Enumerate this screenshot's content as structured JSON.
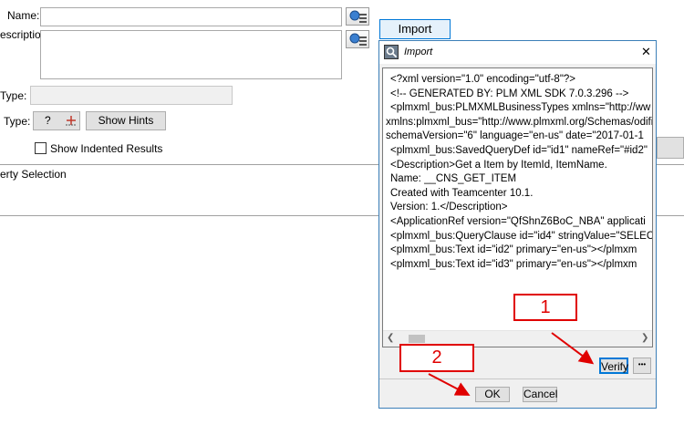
{
  "form": {
    "name_label": "Name:",
    "description_label": "escription:",
    "type_label_1": "Type:",
    "type_label_2": "Type:",
    "type_value": "?",
    "show_hints_label": "Show Hints",
    "show_indented_label": "Show Indented Results",
    "show_indented_checked": false,
    "property_selection_label": "erty Selection",
    "import_button_label": "Import"
  },
  "dialog": {
    "title": "Import",
    "close_glyph": "✕",
    "xml_lines": [
      "<?xml version=\"1.0\" encoding=\"utf-8\"?>",
      "<!-- GENERATED BY: PLM XML SDK 7.0.3.296 -->",
      "<plmxml_bus:PLMXMLBusinessTypes xmlns=\"http://ww",
      "xmlns:plmxml_bus=\"http://www.plmxml.org/Schemas/odifial",
      "schemaVersion=\"6\" language=\"en-us\" date=\"2017-01-1",
      "<plmxml_bus:SavedQueryDef id=\"id1\" nameRef=\"#id2\"",
      "<Description>Get a Item by ItemId, ItemName.",
      "Name: __CNS_GET_ITEM",
      "Created with Teamcenter 10.1.",
      "Version: 1.</Description>",
      "<ApplicationRef version=\"QfShnZ6BoC_NBA\" applicati",
      "<plmxml_bus:QueryClause id=\"id4\" stringValue=\"SELEC",
      "<plmxml_bus:Text id=\"id2\" primary=\"en-us\"></plmxm",
      "<plmxml_bus:Text id=\"id3\" primary=\"en-us\"></plmxm"
    ],
    "verify_label": "Verify",
    "more_label": "•••",
    "ok_label": "OK",
    "cancel_label": "Cancel"
  },
  "annotations": {
    "callout_1": "1",
    "callout_2": "2",
    "color": "#e00000"
  }
}
